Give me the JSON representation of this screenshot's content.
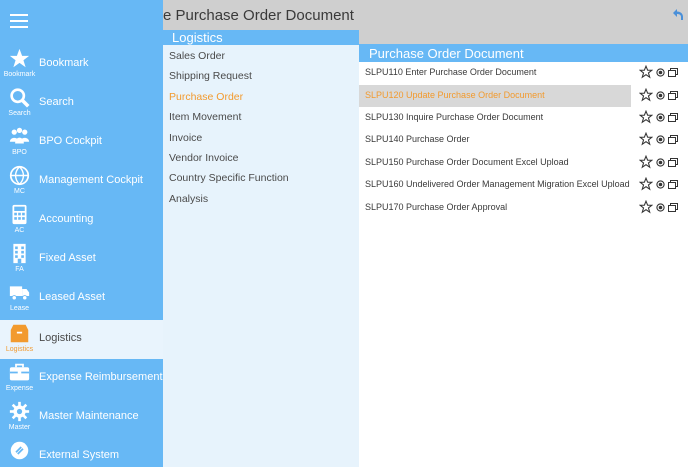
{
  "header": {
    "title": "e Purchase Order Document"
  },
  "sidebar": {
    "items": [
      {
        "label": "Bookmark",
        "short": "Bookmark",
        "icon": "star-icon"
      },
      {
        "label": "Search",
        "short": "Search",
        "icon": "search-icon"
      },
      {
        "label": "BPO Cockpit",
        "short": "BPO",
        "icon": "people-icon"
      },
      {
        "label": "Management Cockpit",
        "short": "MC",
        "icon": "globe-icon"
      },
      {
        "label": "Accounting",
        "short": "AC",
        "icon": "calculator-icon"
      },
      {
        "label": "Fixed Asset",
        "short": "FA",
        "icon": "building-icon"
      },
      {
        "label": "Leased Asset",
        "short": "Lease",
        "icon": "truck-icon"
      },
      {
        "label": "Logistics",
        "short": "Logistics",
        "icon": "box-icon"
      },
      {
        "label": "Expense Reimbursement",
        "short": "Expense",
        "icon": "briefcase-icon"
      },
      {
        "label": "Master Maintenance",
        "short": "Master",
        "icon": "gear-icon"
      },
      {
        "label": "External System",
        "short": "",
        "icon": "link-icon"
      }
    ]
  },
  "submenu": {
    "title": "Logistics",
    "items": [
      {
        "label": "Sales Order"
      },
      {
        "label": "Shipping Request"
      },
      {
        "label": "Purchase Order"
      },
      {
        "label": "Item Movement"
      },
      {
        "label": "Invoice"
      },
      {
        "label": "Vendor Invoice"
      },
      {
        "label": "Country Specific Function"
      },
      {
        "label": "Analysis"
      }
    ]
  },
  "panel": {
    "title": "Purchase Order Document",
    "rows": [
      {
        "label": "SLPU110 Enter Purchase Order Document"
      },
      {
        "label": "SLPU120 Update Purchase Order Document"
      },
      {
        "label": "SLPU130 Inquire Purchase Order Document"
      },
      {
        "label": "SLPU140 Purchase Order"
      },
      {
        "label": "SLPU150 Purchase Order Document Excel Upload"
      },
      {
        "label": "SLPU160 Undelivered Order Management Migration Excel Upload"
      },
      {
        "label": "SLPU170 Purchase Order Approval"
      }
    ]
  },
  "colors": {
    "sidebar": "#67b8f5",
    "accent": "#f29a2e",
    "panel_bg": "#e7f3fc"
  }
}
